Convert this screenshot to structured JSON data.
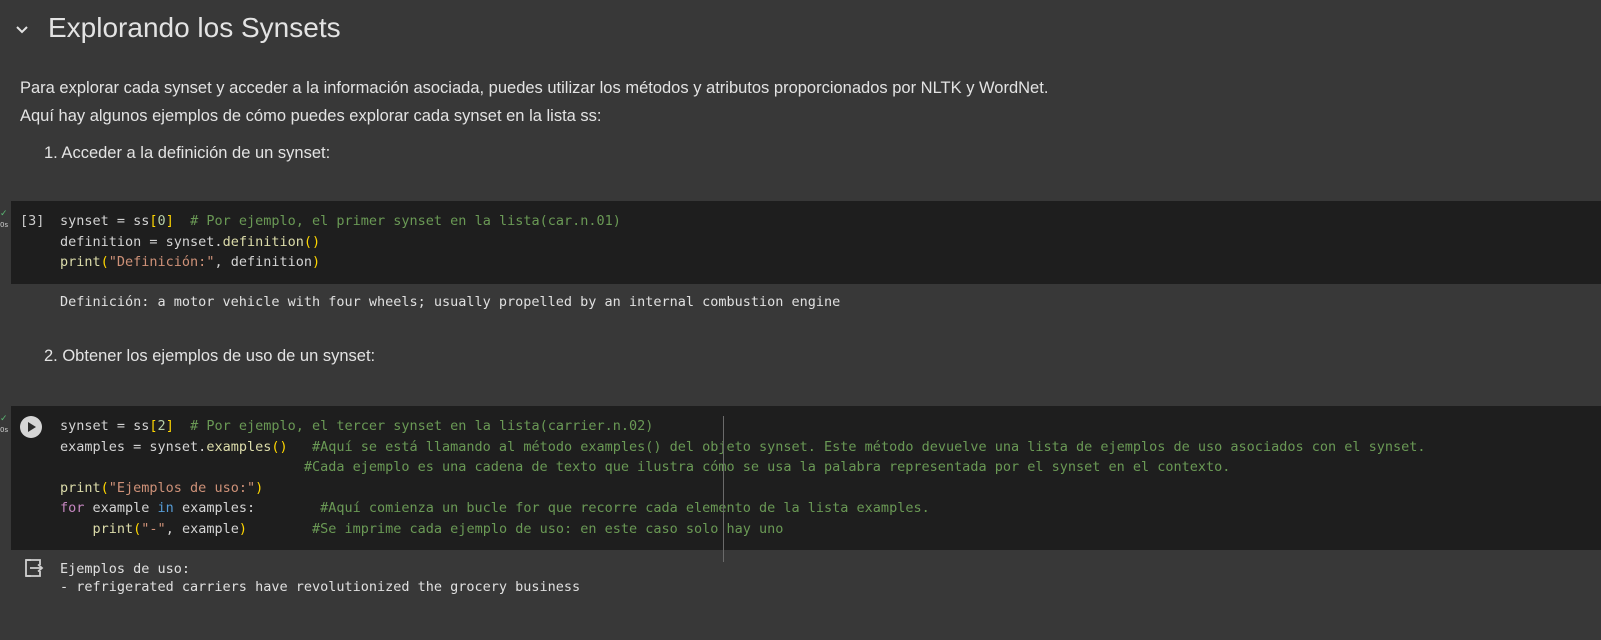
{
  "section": {
    "title": "Explorando los Synsets",
    "chevron_icon": "chevron-down-icon"
  },
  "intro": {
    "line1": "Para explorar cada synset y acceder a la información asociada, puedes utilizar los métodos y atributos proporcionados por NLTK y WordNet.",
    "line2": "Aquí hay algunos ejemplos de cómo puedes explorar cada synset en la lista ss:"
  },
  "steps": [
    {
      "label": "1. Acceder a la definición de un synset:"
    },
    {
      "label": "2. Obtener los ejemplos de uso de un synset:"
    }
  ],
  "cells": [
    {
      "exec_count": "[3]",
      "status_check": "✓",
      "status_time": "0s",
      "output": "Definición: a motor vehicle with four wheels; usually propelled by an internal combustion engine"
    },
    {
      "run_icon": "play-icon",
      "status_check": "✓",
      "status_time": "0s",
      "output_icon": "output-exit-icon",
      "output_line1": "Ejemplos de uso:",
      "output_line2": "- refrigerated carriers have revolutionized the grocery business"
    }
  ],
  "colors": {
    "background": "#383838",
    "code_background": "#1e1e1e",
    "comment": "#6a9955",
    "string": "#ce9178",
    "function": "#dcdcaa",
    "keyword": "#c586c0",
    "bracket": "#ffd700"
  }
}
